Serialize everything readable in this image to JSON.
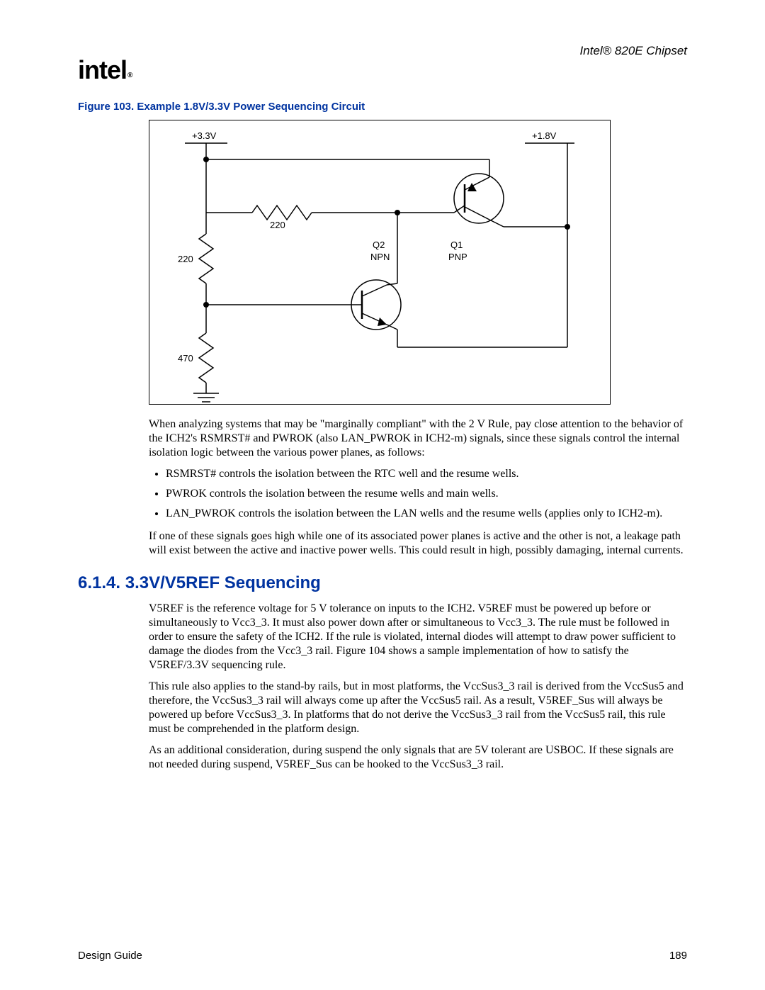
{
  "header": {
    "doc_title": "Intel® 820E Chipset"
  },
  "logo": {
    "text": "intel",
    "registered": "®"
  },
  "figure": {
    "caption": "Figure 103. Example 1.8V/3.3V Power Sequencing Circuit",
    "labels": {
      "v33": "+3.3V",
      "v18": "+1.8V",
      "r220_top": "220",
      "r220_left": "220",
      "r470": "470",
      "q2": "Q2",
      "q2type": "NPN",
      "q1": "Q1",
      "q1type": "PNP"
    }
  },
  "para1": "When analyzing systems that may be \"marginally compliant\" with the 2 V Rule, pay close attention to the behavior of the ICH2's RSMRST# and PWROK (also LAN_PWROK in ICH2-m) signals, since these signals control the internal isolation logic between the various power planes, as follows:",
  "bullets": [
    "RSMRST# controls the isolation between the RTC well and the resume wells.",
    "PWROK controls the isolation between the resume wells and main wells.",
    "LAN_PWROK controls the isolation between the LAN wells and the resume wells (applies only to ICH2-m)."
  ],
  "para2": "If one of these signals goes high while one of its associated power planes is active and the other is not, a leakage path will exist between the active and inactive power wells. This could result in high, possibly damaging, internal currents.",
  "section": {
    "number": "6.1.4.",
    "title": "3.3V/V5REF Sequencing"
  },
  "para3": "V5REF is the reference voltage for 5 V tolerance on inputs to the ICH2. V5REF must be powered up before or simultaneously to Vcc3_3. It must also power down after or simultaneous to Vcc3_3. The rule must be followed in order to ensure the safety of the ICH2. If the rule is violated, internal diodes will attempt to draw power sufficient to damage the diodes from the Vcc3_3 rail. Figure 104 shows a sample implementation of how to satisfy the V5REF/3.3V sequencing rule.",
  "para4": "This rule also applies to the stand-by rails, but in most platforms, the VccSus3_3 rail is derived from the VccSus5 and therefore, the VccSus3_3 rail will always come up after the VccSus5 rail. As a result, V5REF_Sus will always be powered up before VccSus3_3. In platforms that do not derive the VccSus3_3 rail from the VccSus5 rail, this rule must be comprehended in the platform design.",
  "para5": "As an additional consideration, during suspend the only signals that are 5V tolerant are USBOC. If these signals are not needed during suspend, V5REF_Sus can be hooked to the VccSus3_3 rail.",
  "footer": {
    "left": "Design Guide",
    "right": "189"
  }
}
